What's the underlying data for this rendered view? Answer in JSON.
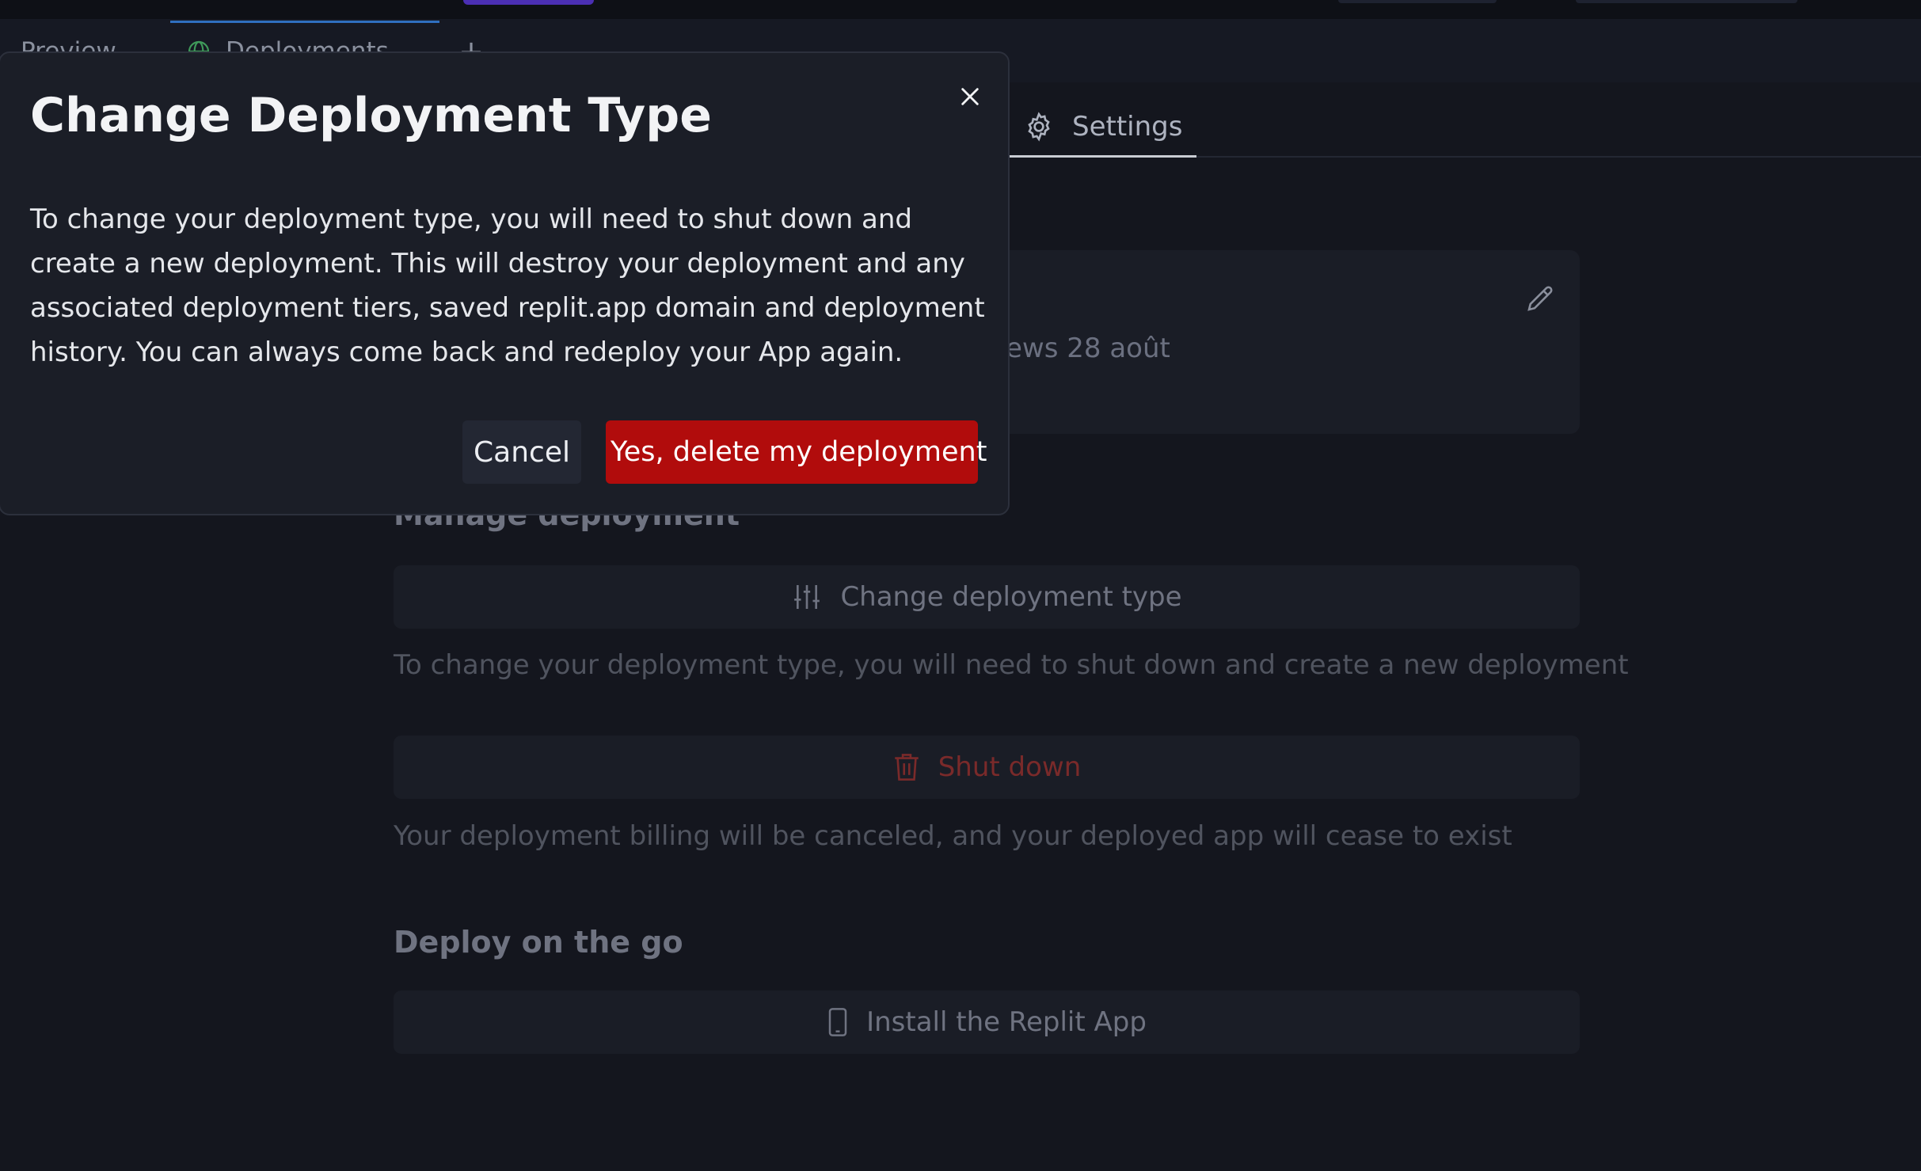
{
  "tabs": [
    {
      "label": "Preview",
      "icon": "preview-icon"
    },
    {
      "label": "Deployments",
      "icon": "globe-icon"
    }
  ],
  "add_tab_icon": "plus-icon",
  "settings_tab": {
    "label": "Settings",
    "icon": "gear-icon"
  },
  "card": {
    "date_fragment": "ews 28 août",
    "icon": "pencil-icon"
  },
  "manage": {
    "title": "Manage deployment",
    "change_button": "Change deployment type",
    "change_helper": "To change your deployment type, you will need to shut down and create a new deployment",
    "shutdown_button": "Shut down",
    "shutdown_helper": "Your deployment billing will be canceled, and your deployed app will cease to exist"
  },
  "deploy_on_go": {
    "title": "Deploy on the go",
    "install_button": "Install the Replit App"
  },
  "modal": {
    "title": "Change Deployment Type",
    "body": "To change your deployment type, you will need to shut down and create a new deployment. This will destroy your deployment and any associated deployment tiers, saved replit.app domain and deployment history. You can always come back and redeploy your App again.",
    "cancel_label": "Cancel",
    "confirm_label": "Yes, delete my deployment",
    "close_icon": "close-icon"
  },
  "colors": {
    "background": "#14161e",
    "modal_bg": "#1b1e27",
    "danger": "#b10c0c",
    "accent_tab": "#2f6fbf"
  }
}
